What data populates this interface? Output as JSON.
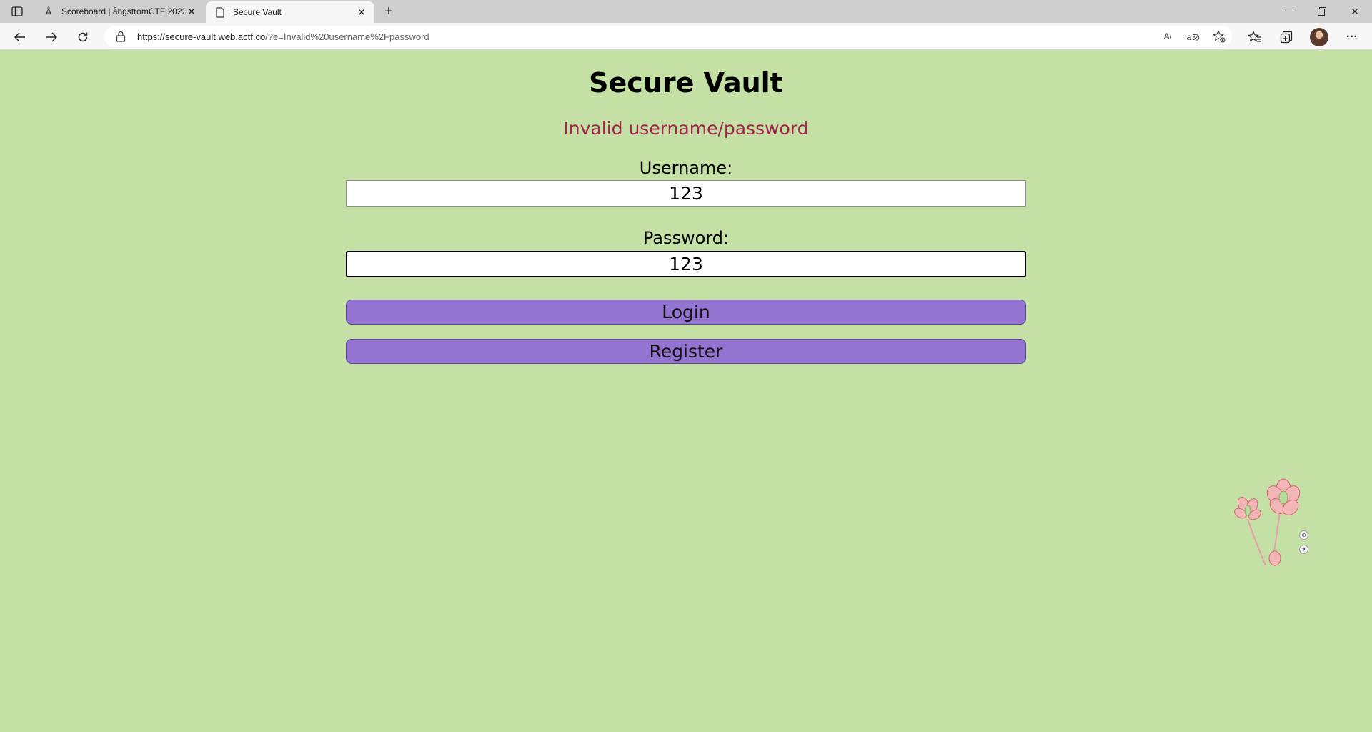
{
  "browser": {
    "tabs": [
      {
        "title": "Scoreboard | ångstromCTF 2022",
        "favicon": "A-logo-icon",
        "active": false
      },
      {
        "title": "Secure Vault",
        "favicon": "page-icon",
        "active": true
      }
    ],
    "address": {
      "url_host": "https://secure-vault.web.actf.co",
      "url_rest": "/?e=Invalid%20username%2Fpassword"
    },
    "icons": [
      "tab-actions-icon",
      "back-icon",
      "forward-icon",
      "reload-icon",
      "lock-icon",
      "read-aloud-icon",
      "translate-icon",
      "add-favorite-icon",
      "favorites-icon",
      "collections-icon",
      "profile-avatar",
      "more-menu-icon"
    ]
  },
  "page": {
    "title": "Secure Vault",
    "error": "Invalid username/password",
    "username_label": "Username:",
    "username_value": "123",
    "password_label": "Password:",
    "password_value": "123",
    "login_label": "Login",
    "register_label": "Register"
  },
  "colors": {
    "background": "#c5e0a5",
    "error": "#a3224a",
    "button": "#9474d1"
  }
}
